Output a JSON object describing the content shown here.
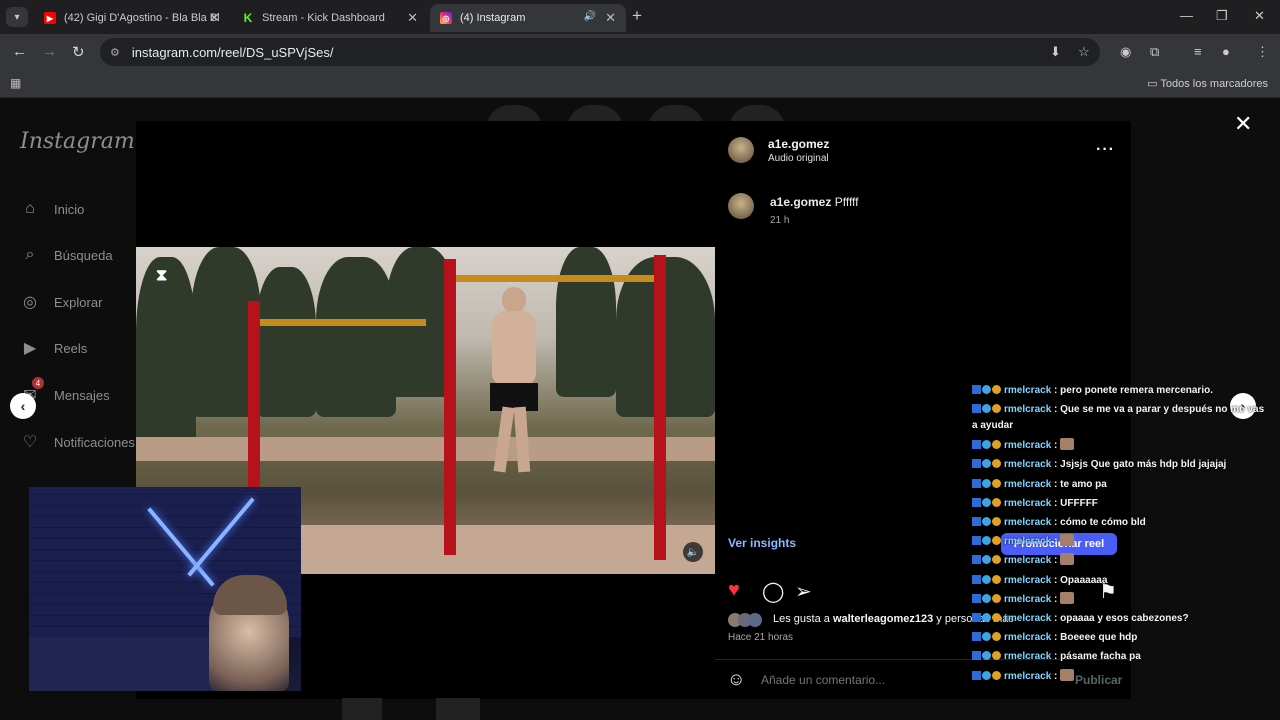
{
  "browser": {
    "tabs": [
      {
        "title": "(42) Gigi D'Agostino - Bla Bla Bl",
        "favicon": "youtube",
        "color": "#ff0000"
      },
      {
        "title": "Stream - Kick Dashboard",
        "favicon": "kick",
        "color": "#53fc18"
      },
      {
        "title": "(4) Instagram",
        "favicon": "instagram",
        "color": "#d62976",
        "active": true
      }
    ],
    "url": "instagram.com/reel/DS_uSPVjSes/",
    "bookmarks_all": "Todos los marcadores"
  },
  "instagram": {
    "logo": "Instagram",
    "nav": [
      {
        "label": "Inicio",
        "icon": "home-icon"
      },
      {
        "label": "Búsqueda",
        "icon": "search-icon"
      },
      {
        "label": "Explorar",
        "icon": "compass-icon"
      },
      {
        "label": "Reels",
        "icon": "reels-icon"
      },
      {
        "label": "Mensajes",
        "icon": "messenger-icon",
        "badge": "4"
      },
      {
        "label": "Notificaciones",
        "icon": "heart-icon"
      }
    ],
    "post": {
      "username": "a1e.gomez",
      "audio": "Audio original",
      "caption_user": "a1e.gomez",
      "caption_text": "Pfffff",
      "caption_time": "21 h",
      "insights": "Ver insights",
      "promote": "Promocionar reel",
      "likes_prefix": "Les gusta a",
      "likes_user": "walterleagomez123",
      "likes_suffix": "y personas más",
      "posted_ago": "Hace 21 horas",
      "comment_placeholder": "Añade un comentario...",
      "publish": "Publicar"
    }
  },
  "stream_chat": [
    {
      "user": "rmelcrack",
      "text": "pero ponete remera mercenario."
    },
    {
      "user": "rmelcrack",
      "text": "Que se me va a parar y después no me vas a ayudar"
    },
    {
      "user": "rmelcrack",
      "text": "",
      "emote": true
    },
    {
      "user": "rmelcrack",
      "text": "Jsjsjs Que gato más hdp bld jajajaj"
    },
    {
      "user": "rmelcrack",
      "text": "te amo pa"
    },
    {
      "user": "rmelcrack",
      "text": "UFFFFF"
    },
    {
      "user": "rmelcrack",
      "text": "cómo te cómo bld"
    },
    {
      "user": "rmelcrack",
      "text": "",
      "emote": true
    },
    {
      "user": "rmelcrack",
      "text": "",
      "emote": true
    },
    {
      "user": "rmelcrack",
      "text": "Opaaaaaa"
    },
    {
      "user": "rmelcrack",
      "text": "",
      "emote": true
    },
    {
      "user": "rmelcrack",
      "text": "opaaaa y esos cabezones?"
    },
    {
      "user": "rmelcrack",
      "text": "Boeeee que hdp"
    },
    {
      "user": "rmelcrack",
      "text": "pásame facha pa"
    },
    {
      "user": "rmelcrack",
      "text": "",
      "emote": true
    }
  ]
}
